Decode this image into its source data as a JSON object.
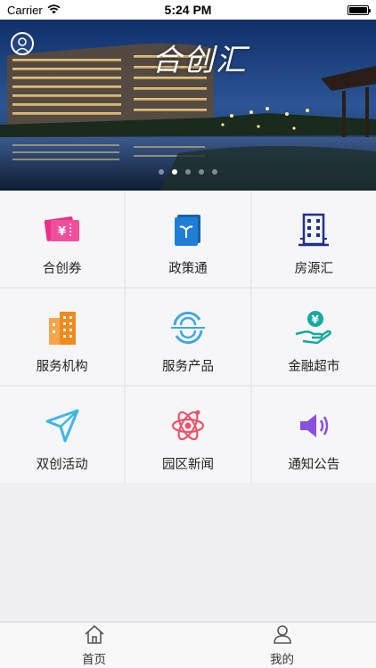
{
  "status_bar": {
    "carrier": "Carrier",
    "time": "5:24 PM",
    "battery_level": 1.0
  },
  "banner": {
    "logo_text": "合创汇",
    "avatar_icon": "user-avatar-icon",
    "slide_count": 5,
    "active_slide": 1
  },
  "grid": {
    "items": [
      {
        "label": "合创券",
        "icon": "coupon-ticket-icon",
        "color": "#e8308c"
      },
      {
        "label": "政策通",
        "icon": "policy-book-icon",
        "color": "#1f7fd6"
      },
      {
        "label": "房源汇",
        "icon": "building-icon",
        "color": "#1f2f8a"
      },
      {
        "label": "服务机构",
        "icon": "office-buildings-icon",
        "color": "#f08a1c"
      },
      {
        "label": "服务产品",
        "icon": "refresh-cycle-icon",
        "color": "#3fa7e0"
      },
      {
        "label": "金融超市",
        "icon": "money-hand-icon",
        "color": "#17a8a0"
      },
      {
        "label": "双创活动",
        "icon": "paper-plane-icon",
        "color": "#3fb5e8"
      },
      {
        "label": "园区新闻",
        "icon": "atom-icon",
        "color": "#e8556a"
      },
      {
        "label": "通知公告",
        "icon": "speaker-icon",
        "color": "#8a4fe0"
      }
    ]
  },
  "tabs": [
    {
      "label": "首页",
      "icon": "home-icon"
    },
    {
      "label": "我的",
      "icon": "profile-icon"
    }
  ]
}
